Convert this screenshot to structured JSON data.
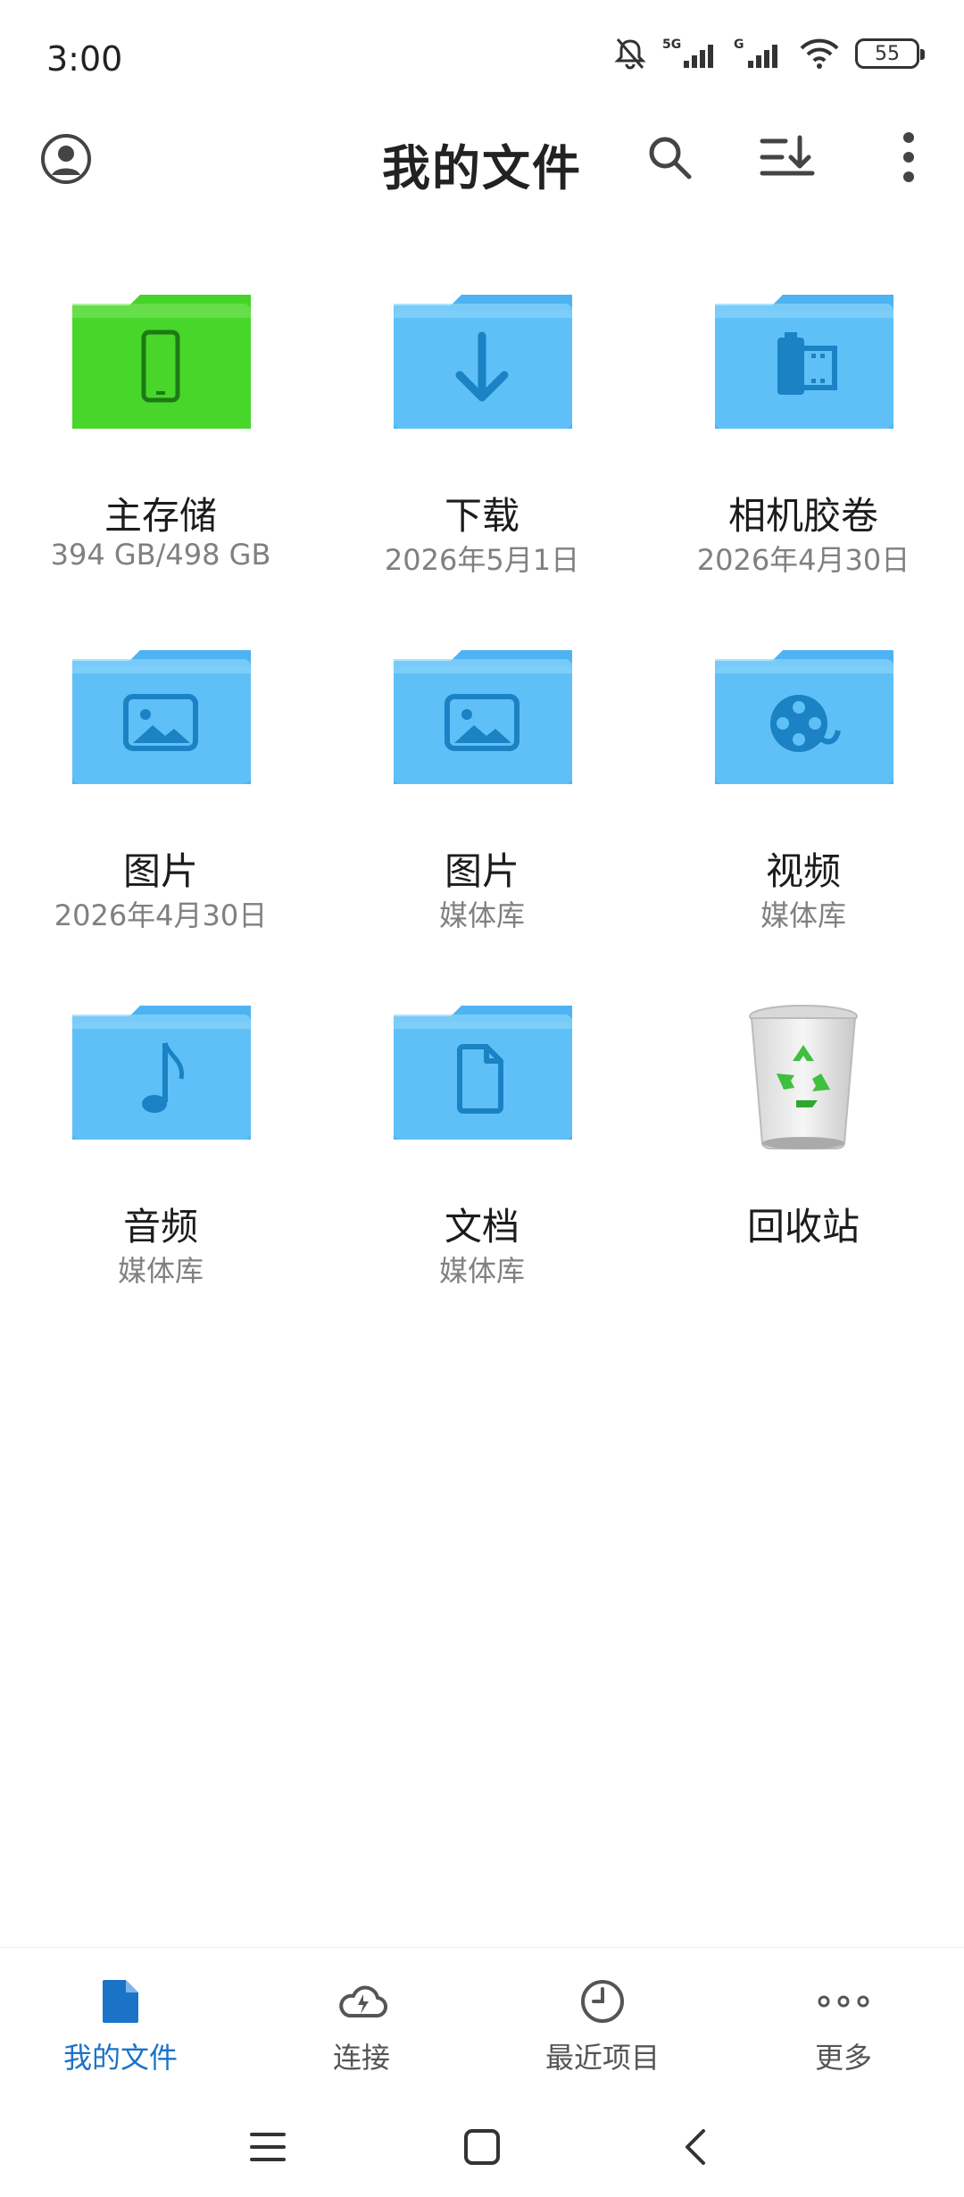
{
  "status_bar": {
    "time": "3:00",
    "battery": "55",
    "icons": [
      "bell-off-icon",
      "signal-5g-icon",
      "signal-g-icon",
      "wifi-icon",
      "battery-icon"
    ]
  },
  "app_bar": {
    "title": "我的文件",
    "icons": [
      "profile-icon",
      "search-icon",
      "sort-icon",
      "more-vertical-icon"
    ]
  },
  "items": [
    {
      "name": "主存储",
      "sub": "394 GB/498 GB",
      "icon": "phone-folder-icon",
      "color": "#3ccf1e"
    },
    {
      "name": "下载",
      "sub": "2026年5月1日",
      "icon": "download-folder-icon",
      "color": "#4fb8f5"
    },
    {
      "name": "相机胶卷",
      "sub": "2026年4月30日",
      "icon": "film-folder-icon",
      "color": "#4fb8f5"
    },
    {
      "name": "图片",
      "sub": "2026年4月30日",
      "icon": "image-folder-icon",
      "color": "#4fb8f5"
    },
    {
      "name": "图片",
      "sub": "媒体库",
      "icon": "image-folder-icon",
      "color": "#4fb8f5"
    },
    {
      "name": "视频",
      "sub": "媒体库",
      "icon": "video-folder-icon",
      "color": "#4fb8f5"
    },
    {
      "name": "音频",
      "sub": "媒体库",
      "icon": "music-folder-icon",
      "color": "#4fb8f5"
    },
    {
      "name": "文档",
      "sub": "媒体库",
      "icon": "document-folder-icon",
      "color": "#4fb8f5"
    },
    {
      "name": "回收站",
      "sub": "",
      "icon": "recycle-bin-icon",
      "color": "#3fbf3f"
    }
  ],
  "bottom_nav": [
    {
      "label": "我的文件",
      "icon": "file-icon",
      "active": true
    },
    {
      "label": "连接",
      "icon": "cloud-icon",
      "active": false
    },
    {
      "label": "最近项目",
      "icon": "clock-icon",
      "active": false
    },
    {
      "label": "更多",
      "icon": "more-horizontal-icon",
      "active": false
    }
  ],
  "system_nav": [
    "menu-icon",
    "home-icon",
    "back-icon"
  ],
  "colors": {
    "accent": "#1a73c7",
    "folder_blue": "#4fb8f5",
    "folder_green": "#3ccf1e"
  }
}
